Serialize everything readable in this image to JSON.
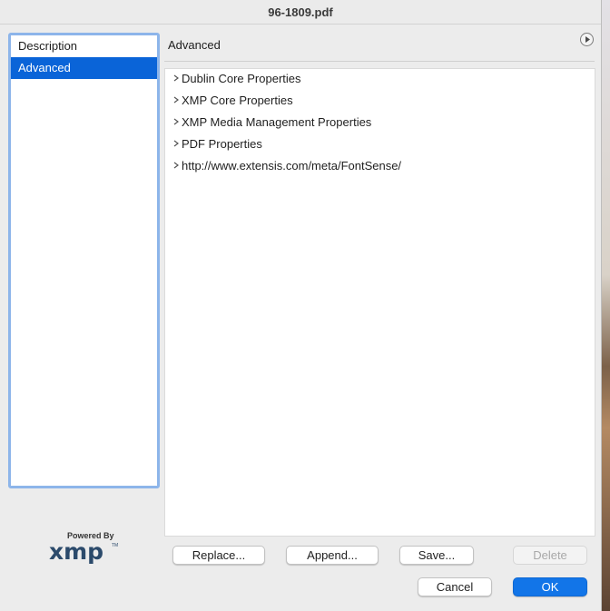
{
  "window": {
    "title": "96-1809.pdf"
  },
  "sidebar": {
    "items": [
      {
        "label": "Description",
        "selected": false
      },
      {
        "label": "Advanced",
        "selected": true
      }
    ]
  },
  "panel": {
    "title": "Advanced",
    "menu_icon": "circle-arrow-right-icon",
    "tree_items": [
      "Dublin Core Properties",
      "XMP Core Properties",
      "XMP Media Management Properties",
      "PDF Properties",
      "http://www.extensis.com/meta/FontSense/"
    ]
  },
  "logo": {
    "powered_by": "Powered By",
    "brand": "xmp",
    "tm": "TM"
  },
  "buttons": {
    "replace": "Replace...",
    "append": "Append...",
    "save": "Save...",
    "delete": "Delete",
    "cancel": "Cancel",
    "ok": "OK"
  },
  "colors": {
    "accent": "#0a64d8",
    "primary_button": "#1275e8",
    "sidebar_focus": "#8db5ea"
  }
}
